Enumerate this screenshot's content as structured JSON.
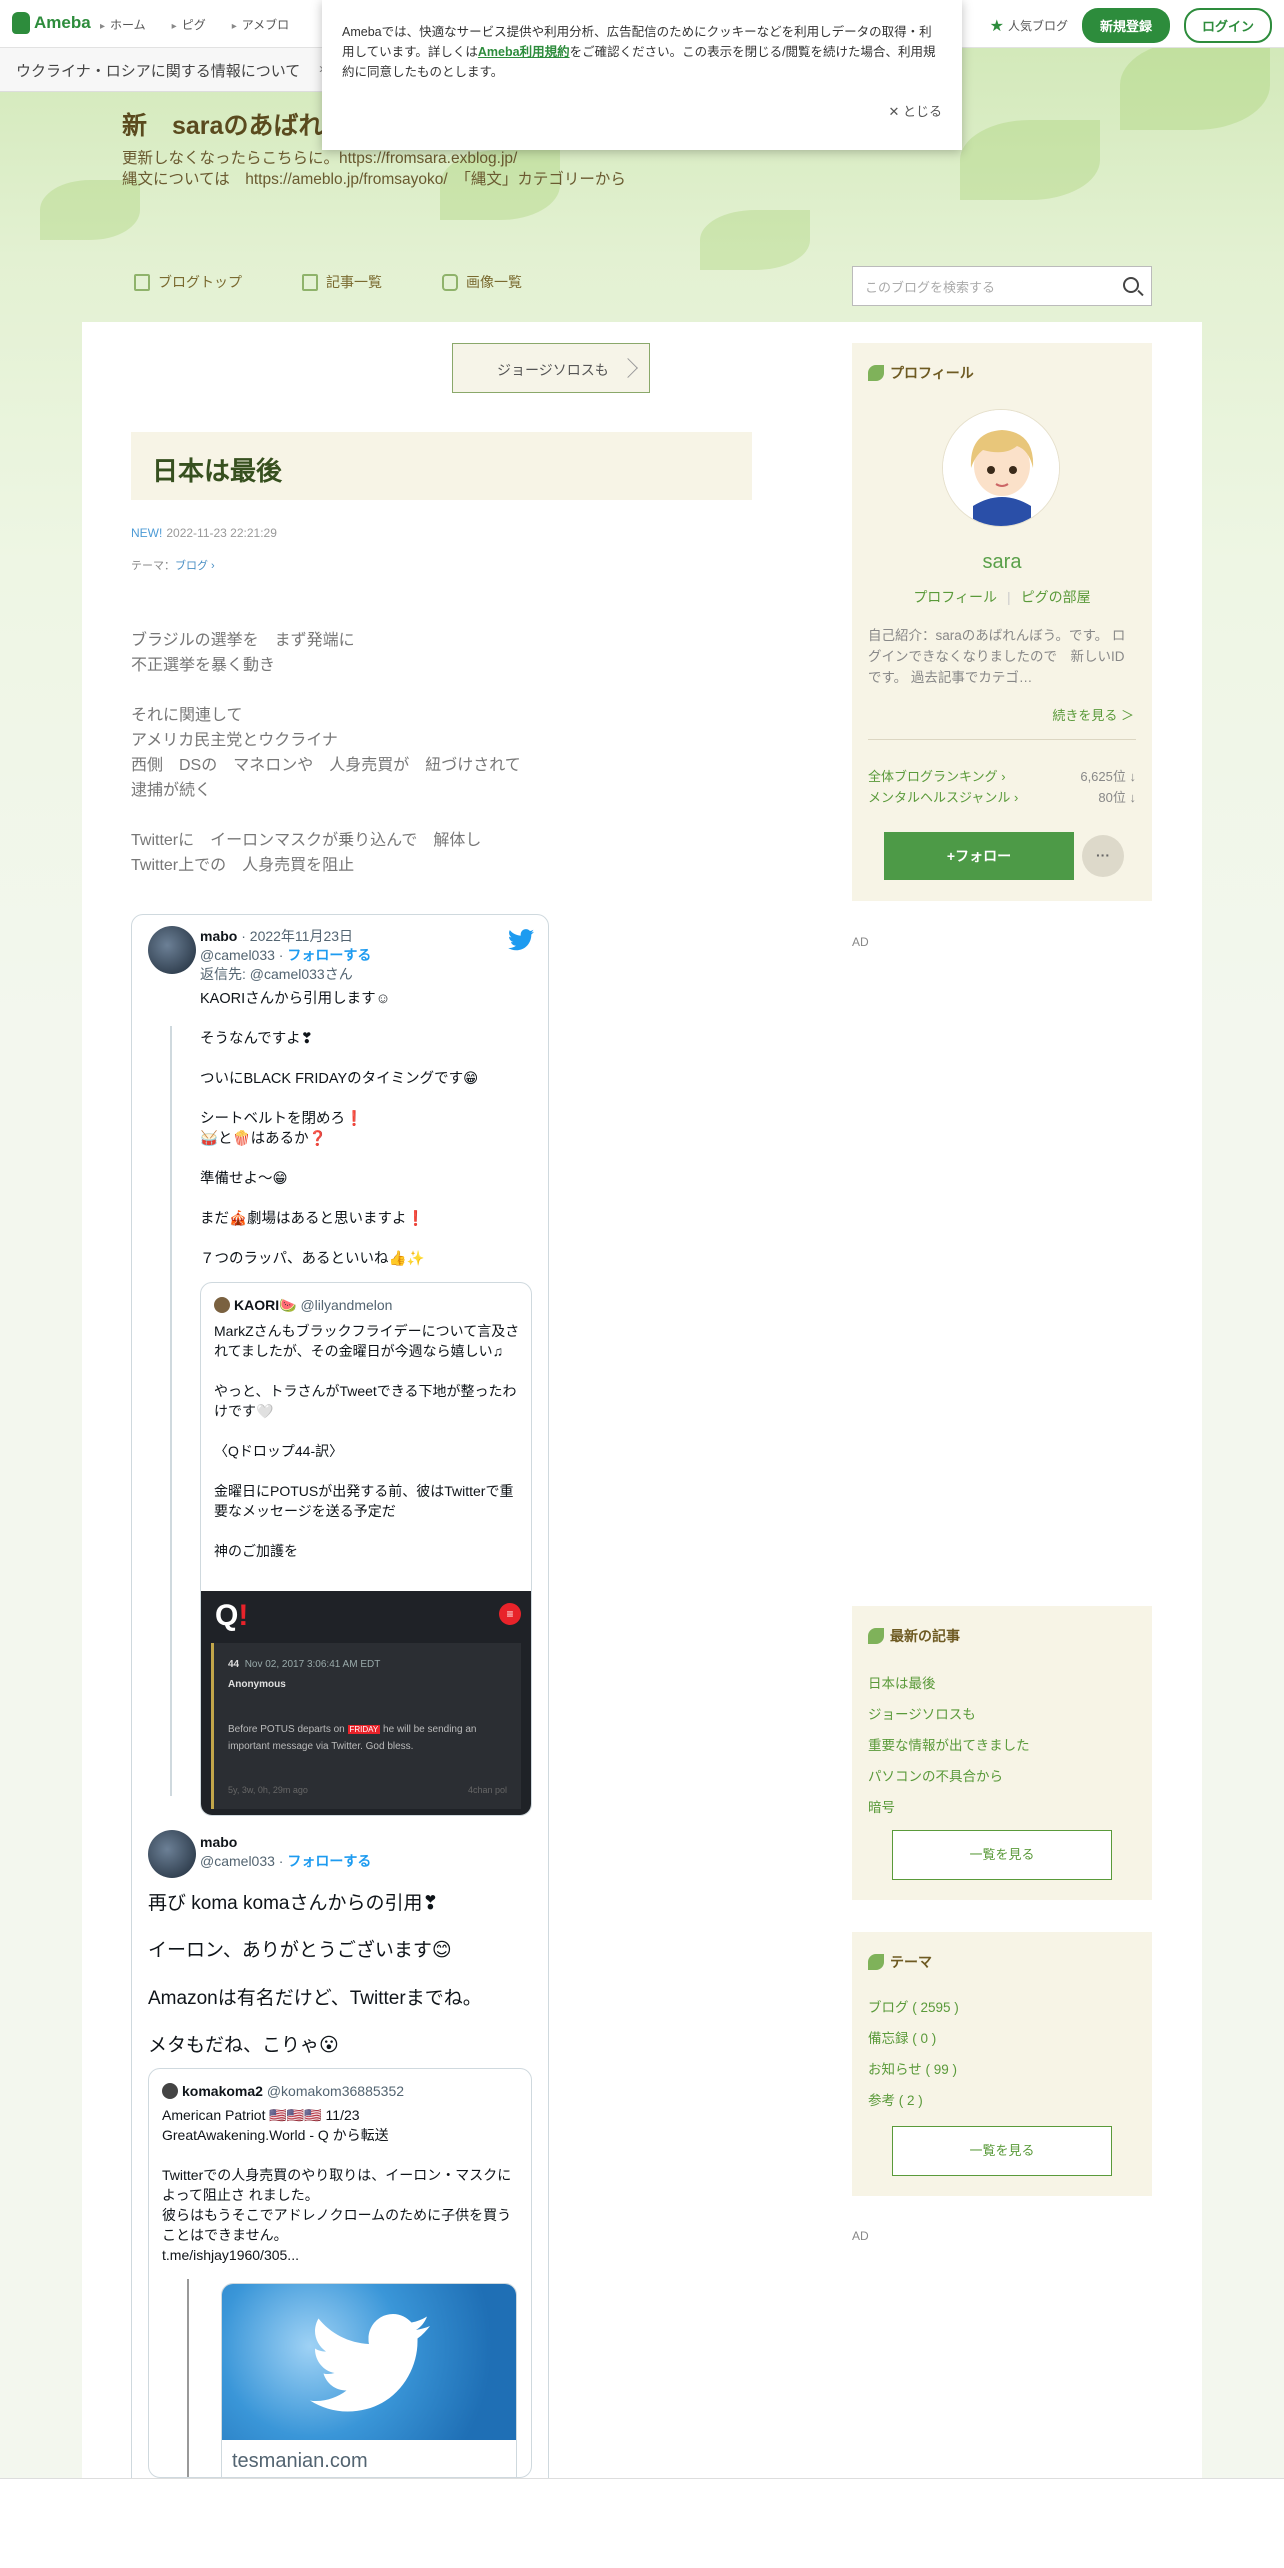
{
  "global_nav": {
    "logo": "Ameba",
    "items": [
      "ホーム",
      "ピグ",
      "アメブロ"
    ],
    "popular_blog": "人気ブログ",
    "register": "新規登録",
    "login": "ログイン"
  },
  "notice_bar": {
    "text": "ウクライナ・ロシアに関する情報について",
    "chevron": "›"
  },
  "cookie": {
    "text_before": "Amebaでは、快適なサービス提供や利用分析、広告配信のためにクッキーなどを利用しデータの取得・利用しています。詳しくは",
    "link": "Ameba利用規約",
    "text_after": "をご確認ください。この表示を閉じる/閲覧を続けた場合、利用規約に同意したものとします。",
    "close": "✕ とじる"
  },
  "blog": {
    "title": "新　saraのあばれんぼう",
    "desc_line1": "更新しなくなったらこちらに。https://fromsara.exblog.jp/",
    "desc_line2": "縄文については　https://ameblo.jp/fromsayoko/　「縄文」カテゴリーから",
    "nav": [
      "ブログトップ",
      "記事一覧",
      "画像一覧"
    ],
    "search_placeholder": "このブログを検索する"
  },
  "article": {
    "prev_link": "ジョージソロスも",
    "title": "日本は最後",
    "new_label": "NEW!",
    "date": "2022-11-23 22:21:29",
    "theme_label": "テーマ：",
    "theme": "ブログ ›",
    "body": [
      "ブラジルの選挙を　まず発端に",
      "不正選挙を暴く動き",
      "",
      "それに関連して",
      "アメリカ民主党とウクライナ",
      "西側　DSの　マネロンや　人身売買が　紐づけされて",
      "逮捕が続く",
      "",
      "Twitterに　イーロンマスクが乗り込んで　解体し",
      "Twitter上での　人身売買を阻止"
    ]
  },
  "tweet1": {
    "name": "mabo",
    "date": "· 2022年11月23日",
    "handle": "@camel033 ·",
    "follow": "フォローする",
    "reply_to": "返信先: @camel033さん",
    "lines": [
      "KAORIさんから引用します☺",
      "",
      "そうなんですよ❣",
      "",
      "ついにBLACK FRIDAYのタイミングです😁",
      "",
      "シートベルトを閉めろ❗",
      "🥁と🍿はあるか❓",
      "",
      "準備せよ〜😁",
      "",
      "まだ🎪劇場はあると思いますよ❗",
      "",
      "７つのラッパ、あるといいね👍✨"
    ]
  },
  "quote1": {
    "name": "KAORI🍉",
    "handle": "@lilyandmelon",
    "lines": [
      "MarkZさんもブラックフライデーについて言及されてましたが、その金曜日が今週なら嬉しい♫",
      "",
      "やっと、トラさんがTweetできる下地が整ったわけです🤍",
      "",
      "〈Qドロップ44-訳〉",
      "",
      "金曜日にPOTUSが出発する前、彼はTwitterで重要なメッセージを送る予定だ",
      "",
      "神のご加護を"
    ],
    "qimg": {
      "post_no": "44",
      "post_date": "Nov 02, 2017 3:06:41 AM EDT",
      "author": "Anonymous",
      "msg_before": "Before POTUS departs on",
      "msg_tag": "FRIDAY",
      "msg_after": "he will be sending an important message via Twitter. God bless.",
      "footer_left": "5y, 3w, 0h, 29m ago",
      "footer_right": "4chan pol"
    }
  },
  "tweet2": {
    "name": "mabo",
    "handle": "@camel033 ·",
    "follow": "フォローする",
    "lines": [
      "再び koma komaさんからの引用❣",
      "イーロン、ありがとうございます😊",
      "Amazonは有名だけど、Twitterまでね。",
      "メタもだね、こりゃ😮"
    ]
  },
  "quote2": {
    "name": "komakoma2",
    "handle": "@komakom36885352",
    "lines": [
      "American Patriot 🇺🇸🇺🇸🇺🇸 11/23",
      "GreatAwakening.World - Q から転送",
      "",
      "Twitterでの人身売買のやり取りは、イーロン・マスクによって阻止さ れました。",
      "彼らはもうそこでアドレノクロームのために子供を買うことはできません。",
      "t.me/ishjay1960/305..."
    ],
    "card_url": "tesmanian.com"
  },
  "profile": {
    "header": "プロフィール",
    "name": "sara",
    "link1": "プロフィール",
    "link2": "ピグの部屋",
    "intro": "自己紹介：saraのあばれんぼう。です。 ログインできなくなりましたので　新しいIDです。 過去記事でカテゴ…",
    "more": "続きを見る ＞",
    "rank1_label": "全体ブログランキング ›",
    "rank1_value": "6,625位 ↓",
    "rank2_label": "メンタルヘルスジャンル ›",
    "rank2_value": "80位 ↓",
    "follow": "+フォロー",
    "dots": "···"
  },
  "ad_label": "AD",
  "recent": {
    "header": "最新の記事",
    "items": [
      "日本は最後",
      "ジョージソロスも",
      "重要な情報が出てきました",
      "パソコンの不具合から",
      "暗号"
    ],
    "button": "一覧を見る"
  },
  "themes": {
    "header": "テーマ",
    "items": [
      "ブログ ( 2595 )",
      "備忘録 ( 0 )",
      "お知らせ ( 99 )",
      "参考 ( 2 )"
    ],
    "button": "一覧を見る"
  }
}
